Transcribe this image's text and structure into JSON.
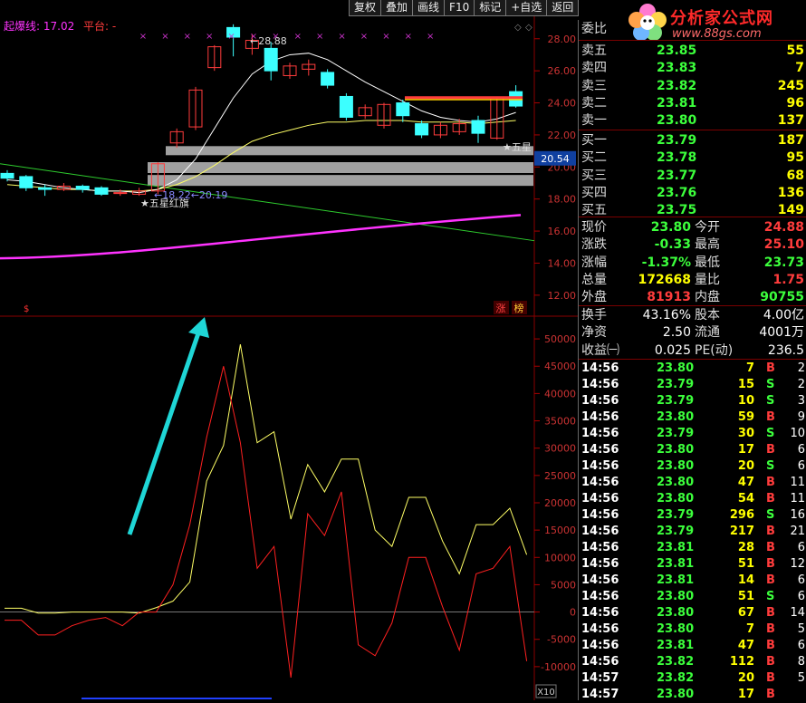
{
  "toolbar": {
    "buttons": [
      "复权",
      "叠加",
      "画线",
      "F10",
      "标记",
      "+自选",
      "返回"
    ]
  },
  "logo": {
    "title": "分析家公式网",
    "url": "www.88gs.com",
    "obscured_prefix": "3"
  },
  "legend": {
    "item1": "起爆线: 17.02",
    "item2": "平台: -"
  },
  "price_axis": {
    "ticks": [
      "28.00",
      "26.00",
      "24.00",
      "22.00",
      "20.00",
      "18.00",
      "16.00",
      "14.00",
      "12.00"
    ],
    "current_price_label": "20.54"
  },
  "annotations": {
    "high": "28.88",
    "low": "18.22",
    "low2": "20.19",
    "star1": "★五星红旗",
    "star2": "★五星"
  },
  "indicator_axis": {
    "ticks": [
      "50000",
      "45000",
      "40000",
      "35000",
      "30000",
      "25000",
      "20000",
      "15000",
      "10000",
      "5000",
      "0",
      "-5000",
      "-10000"
    ],
    "multiplier": "X10"
  },
  "badges": {
    "zhang": "涨",
    "bang": "榜",
    "s_icon": "$"
  },
  "order_book": {
    "weibi_label": "委比",
    "asks": [
      {
        "label": "卖五",
        "price": "23.85",
        "vol": "55"
      },
      {
        "label": "卖四",
        "price": "23.83",
        "vol": "7"
      },
      {
        "label": "卖三",
        "price": "23.82",
        "vol": "245"
      },
      {
        "label": "卖二",
        "price": "23.81",
        "vol": "96"
      },
      {
        "label": "卖一",
        "price": "23.80",
        "vol": "137"
      }
    ],
    "bids": [
      {
        "label": "买一",
        "price": "23.79",
        "vol": "187"
      },
      {
        "label": "买二",
        "price": "23.78",
        "vol": "95"
      },
      {
        "label": "买三",
        "price": "23.77",
        "vol": "68"
      },
      {
        "label": "买四",
        "price": "23.76",
        "vol": "136"
      },
      {
        "label": "买五",
        "price": "23.75",
        "vol": "149"
      }
    ]
  },
  "quote": {
    "rows": [
      {
        "l1": "现价",
        "v1": "23.80",
        "c1": "green",
        "l2": "今开",
        "v2": "24.88",
        "c2": "red"
      },
      {
        "l1": "涨跌",
        "v1": "-0.33",
        "c1": "green",
        "l2": "最高",
        "v2": "25.10",
        "c2": "red"
      },
      {
        "l1": "涨幅",
        "v1": "-1.37%",
        "c1": "green",
        "l2": "最低",
        "v2": "23.73",
        "c2": "green"
      },
      {
        "l1": "总量",
        "v1": "172668",
        "c1": "yellow",
        "l2": "量比",
        "v2": "1.75",
        "c2": "red"
      },
      {
        "l1": "外盘",
        "v1": "81913",
        "c1": "red",
        "l2": "内盘",
        "v2": "90755",
        "c2": "green"
      }
    ],
    "rows2": [
      {
        "l1": "换手",
        "v1": "43.16%",
        "l2": "股本",
        "v2": "4.00亿"
      },
      {
        "l1": "净资",
        "v1": "2.50",
        "l2": "流通",
        "v2": "4001万"
      },
      {
        "l1": "收益㈠",
        "v1": "0.025",
        "l2": "PE(动)",
        "v2": "236.5"
      }
    ]
  },
  "trades": [
    {
      "t": "14:56",
      "p": "23.80",
      "pc": "green",
      "v": "7",
      "s": "B",
      "n": "2"
    },
    {
      "t": "14:56",
      "p": "23.79",
      "pc": "green",
      "v": "15",
      "s": "S",
      "n": "2"
    },
    {
      "t": "14:56",
      "p": "23.79",
      "pc": "green",
      "v": "10",
      "s": "S",
      "n": "3"
    },
    {
      "t": "14:56",
      "p": "23.80",
      "pc": "green",
      "v": "59",
      "s": "B",
      "n": "9"
    },
    {
      "t": "14:56",
      "p": "23.79",
      "pc": "green",
      "v": "30",
      "s": "S",
      "n": "10"
    },
    {
      "t": "14:56",
      "p": "23.80",
      "pc": "green",
      "v": "17",
      "s": "B",
      "n": "6"
    },
    {
      "t": "14:56",
      "p": "23.80",
      "pc": "green",
      "v": "20",
      "s": "S",
      "n": "6"
    },
    {
      "t": "14:56",
      "p": "23.80",
      "pc": "green",
      "v": "47",
      "s": "B",
      "n": "11"
    },
    {
      "t": "14:56",
      "p": "23.80",
      "pc": "green",
      "v": "54",
      "s": "B",
      "n": "11"
    },
    {
      "t": "14:56",
      "p": "23.79",
      "pc": "green",
      "v": "296",
      "s": "S",
      "n": "16"
    },
    {
      "t": "14:56",
      "p": "23.79",
      "pc": "green",
      "v": "217",
      "s": "B",
      "n": "21"
    },
    {
      "t": "14:56",
      "p": "23.81",
      "pc": "green",
      "v": "28",
      "s": "B",
      "n": "6"
    },
    {
      "t": "14:56",
      "p": "23.81",
      "pc": "green",
      "v": "51",
      "s": "B",
      "n": "12"
    },
    {
      "t": "14:56",
      "p": "23.81",
      "pc": "green",
      "v": "14",
      "s": "B",
      "n": "6"
    },
    {
      "t": "14:56",
      "p": "23.80",
      "pc": "green",
      "v": "51",
      "s": "S",
      "n": "6"
    },
    {
      "t": "14:56",
      "p": "23.80",
      "pc": "green",
      "v": "67",
      "s": "B",
      "n": "14"
    },
    {
      "t": "14:56",
      "p": "23.80",
      "pc": "green",
      "v": "7",
      "s": "B",
      "n": "5"
    },
    {
      "t": "14:56",
      "p": "23.81",
      "pc": "green",
      "v": "47",
      "s": "B",
      "n": "6"
    },
    {
      "t": "14:56",
      "p": "23.82",
      "pc": "green",
      "v": "112",
      "s": "B",
      "n": "8"
    },
    {
      "t": "14:57",
      "p": "23.82",
      "pc": "green",
      "v": "20",
      "s": "B",
      "n": "5"
    },
    {
      "t": "14:57",
      "p": "23.80",
      "pc": "green",
      "v": "17",
      "s": "B",
      "n": ""
    }
  ],
  "colors": {
    "up": "#ff3c3c",
    "down": "#3cffff",
    "ma1": "#ffffff",
    "ma2": "#ffff66",
    "ma3": "#ff33ff",
    "trend": "#2ecc2e",
    "indicatorA": "#ffff66",
    "indicatorB": "#ff2020",
    "arrow": "#1fd6d6",
    "platform": "#a0a0a0"
  },
  "chart_data": {
    "type": "candlestick",
    "y_range_price": [
      11.2,
      29.4
    ],
    "candles": [
      {
        "o": 19.6,
        "c": 19.3,
        "h": 19.8,
        "l": 19.1
      },
      {
        "o": 19.4,
        "c": 18.7,
        "h": 19.5,
        "l": 18.5
      },
      {
        "o": 18.7,
        "c": 18.6,
        "h": 18.9,
        "l": 18.2
      },
      {
        "o": 18.6,
        "c": 18.8,
        "h": 19.0,
        "l": 18.5
      },
      {
        "o": 18.8,
        "c": 18.6,
        "h": 18.9,
        "l": 18.4
      },
      {
        "o": 18.7,
        "c": 18.3,
        "h": 18.8,
        "l": 18.2
      },
      {
        "o": 18.4,
        "c": 18.4,
        "h": 18.6,
        "l": 18.2
      },
      {
        "o": 18.3,
        "c": 18.5,
        "h": 18.7,
        "l": 18.2
      },
      {
        "o": 18.5,
        "c": 20.2,
        "h": 20.3,
        "l": 18.3
      },
      {
        "o": 21.5,
        "c": 22.2,
        "h": 22.4,
        "l": 21.2
      },
      {
        "o": 22.5,
        "c": 24.8,
        "h": 25.0,
        "l": 22.3
      },
      {
        "o": 26.2,
        "c": 27.5,
        "h": 27.6,
        "l": 26.0
      },
      {
        "o": 28.7,
        "c": 28.1,
        "h": 28.9,
        "l": 26.9
      },
      {
        "o": 27.4,
        "c": 27.9,
        "h": 28.3,
        "l": 27.0
      },
      {
        "o": 27.4,
        "c": 26.0,
        "h": 27.8,
        "l": 25.4
      },
      {
        "o": 25.7,
        "c": 26.3,
        "h": 26.5,
        "l": 25.5
      },
      {
        "o": 26.1,
        "c": 26.4,
        "h": 26.7,
        "l": 25.7
      },
      {
        "o": 25.9,
        "c": 25.1,
        "h": 26.1,
        "l": 24.9
      },
      {
        "o": 24.4,
        "c": 23.1,
        "h": 24.6,
        "l": 22.9
      },
      {
        "o": 23.2,
        "c": 23.7,
        "h": 23.9,
        "l": 23.0
      },
      {
        "o": 22.6,
        "c": 23.9,
        "h": 24.0,
        "l": 22.4
      },
      {
        "o": 24.0,
        "c": 23.2,
        "h": 24.2,
        "l": 22.8
      },
      {
        "o": 22.7,
        "c": 22.0,
        "h": 22.9,
        "l": 21.8
      },
      {
        "o": 22.0,
        "c": 22.6,
        "h": 22.8,
        "l": 21.8
      },
      {
        "o": 22.2,
        "c": 22.7,
        "h": 23.0,
        "l": 22.0
      },
      {
        "o": 22.9,
        "c": 22.1,
        "h": 23.2,
        "l": 21.5
      },
      {
        "o": 21.8,
        "c": 24.3,
        "h": 24.4,
        "l": 21.7
      },
      {
        "o": 24.7,
        "c": 23.8,
        "h": 25.1,
        "l": 23.7
      }
    ],
    "indicator_range": [
      -14000,
      53000
    ],
    "series": [
      {
        "name": "",
        "values": [
          700,
          700,
          -200,
          -200,
          0,
          0,
          0,
          0,
          -200,
          800,
          2000,
          5500,
          24000,
          30500,
          49000,
          31000,
          33000,
          17000,
          27000,
          22000,
          28000,
          28000,
          15000,
          12000,
          21000,
          21000,
          13000,
          7000,
          16000,
          16000,
          19000,
          10500
        ]
      },
      {
        "name": "",
        "values": [
          -1500,
          -1500,
          -4200,
          -4200,
          -2500,
          -1500,
          -1000,
          -2500,
          0,
          0,
          5000,
          16000,
          32000,
          45000,
          31000,
          8000,
          12000,
          -12000,
          18000,
          14000,
          22000,
          -6000,
          -8000,
          -2000,
          10000,
          10000,
          1000,
          -7000,
          7000,
          8000,
          12000,
          -9000
        ]
      }
    ]
  }
}
